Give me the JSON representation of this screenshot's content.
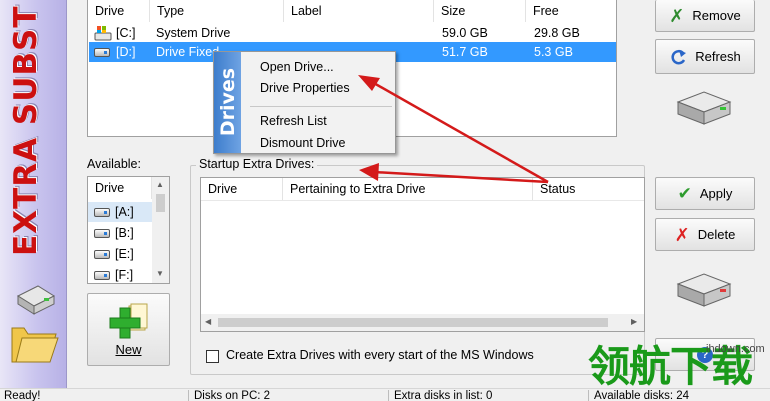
{
  "banner": {
    "title": "EXTRA SUBST"
  },
  "drives_list": {
    "columns": [
      "Drive",
      "Type",
      "Label",
      "Size",
      "Free"
    ],
    "rows": [
      {
        "drive": "[C:]",
        "type": "System Drive",
        "label": "",
        "size": "59.0 GB",
        "free": "29.8 GB",
        "icon": "windows-drive-icon"
      },
      {
        "drive": "[D:]",
        "type": "Drive Fixed",
        "label": "",
        "size": "51.7 GB",
        "free": "5.3 GB",
        "icon": "drive-icon",
        "selected": true
      }
    ]
  },
  "context_menu": {
    "strip_label": "Drives",
    "items": [
      "Open Drive...",
      "Drive Properties",
      "Refresh List",
      "Dismount Drive"
    ]
  },
  "top_buttons": {
    "remove": "Remove",
    "refresh": "Refresh"
  },
  "available": {
    "label": "Available:",
    "column": "Drive",
    "items": [
      "[A:]",
      "[B:]",
      "[E:]",
      "[F:]"
    ]
  },
  "new_button": {
    "label": "New"
  },
  "startup": {
    "label": "Startup Extra Drives:",
    "columns": [
      "Drive",
      "Pertaining to Extra Drive",
      "Status"
    ]
  },
  "startup_buttons": {
    "apply": "Apply",
    "delete": "Delete"
  },
  "checkbox": {
    "label": "Create Extra Drives with every start of the MS Windows",
    "checked": false
  },
  "status_bar": {
    "ready": "Ready!",
    "disks_on_pc": "Disks on PC: 2",
    "extra_disks": "Extra disks in list: 0",
    "available_disks": "Available disks: 24"
  },
  "watermark": {
    "text": "领航下载",
    "url": "ihdown.com"
  },
  "colors": {
    "selection": "#3399ff",
    "banner_text": "#cc1010",
    "menu_strip": "#3d7dcc",
    "arrow": "#d41a1a"
  }
}
